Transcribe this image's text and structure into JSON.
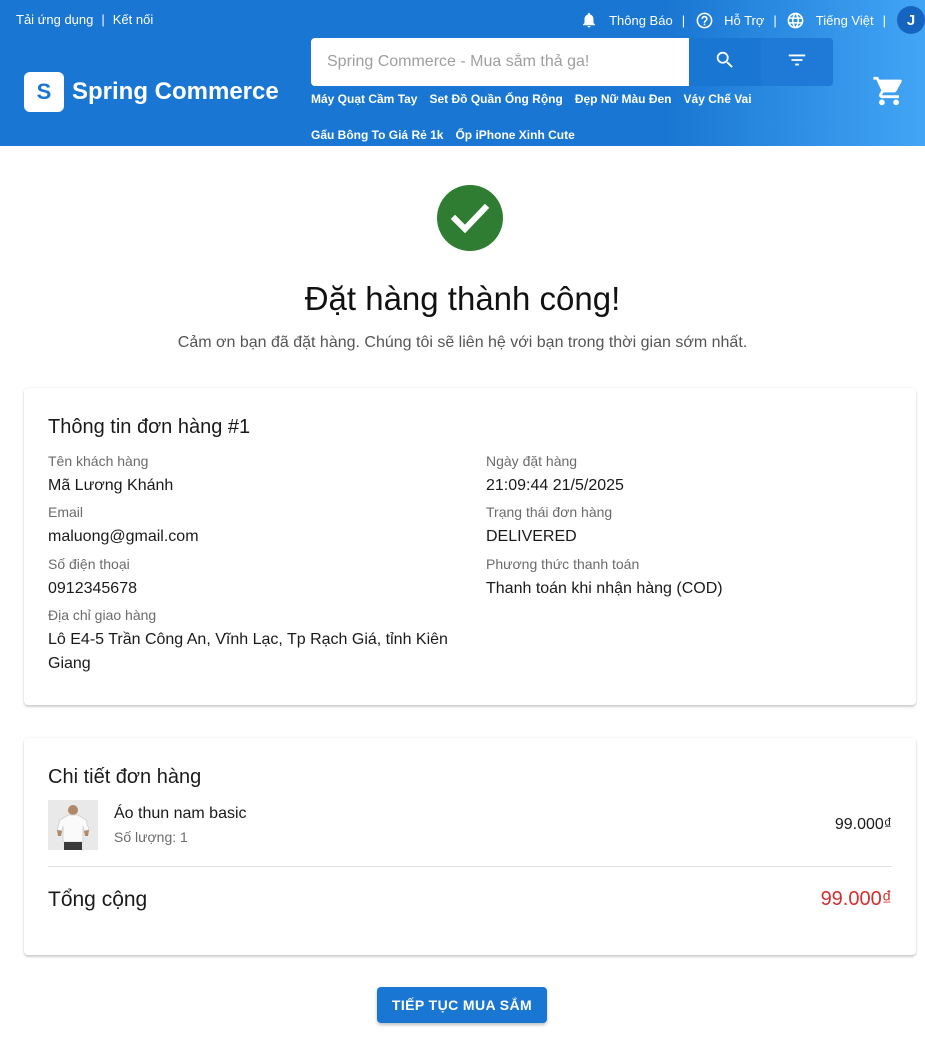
{
  "header": {
    "download_app": "Tải ứng dụng",
    "separator": "|",
    "connect": "Kết nối",
    "notifications": "Thông Báo",
    "support": "Hỗ Trợ",
    "language": "Tiếng Việt",
    "avatar_letter": "J",
    "logo_letter": "S",
    "brand": "Spring Commerce",
    "search_placeholder": "Spring Commerce - Mua sắm thả ga!",
    "tags": [
      "Máy Quạt Cầm Tay",
      "Set Đồ Quần Ống Rộng",
      "Đẹp Nữ Màu Đen",
      "Váy Chế Vai",
      "Gấu Bông To Giá Rẻ 1k",
      "Ốp iPhone Xinh Cute"
    ],
    "icons": [
      "bell-icon",
      "help-circle-icon",
      "globe-icon",
      "search-icon",
      "filter-icon",
      "cart-icon"
    ]
  },
  "success": {
    "icon": "check-circle-icon",
    "title": "Đặt hàng thành công!",
    "message": "Cảm ơn bạn đã đặt hàng. Chúng tôi sẽ liên hệ với bạn trong thời gian sớm nhất."
  },
  "order_info": {
    "title": "Thông tin đơn hàng #1",
    "customer_name_label": "Tên khách hàng",
    "customer_name": "Mã Lương Khánh",
    "email_label": "Email",
    "email": "maluong@gmail.com",
    "phone_label": "Số điện thoại",
    "phone": "0912345678",
    "address_label": "Địa chỉ giao hàng",
    "address": "Lô E4-5 Trần Công An, Vĩnh Lạc, Tp Rạch Giá, tỉnh Kiên Giang",
    "order_date_label": "Ngày đặt hàng",
    "order_date": "21:09:44 21/5/2025",
    "status_label": "Trạng thái đơn hàng",
    "status": "DELIVERED",
    "payment_label": "Phương thức thanh toán",
    "payment": "Thanh toán khi nhận hàng (COD)"
  },
  "order_details": {
    "title": "Chi tiết đơn hàng",
    "items": [
      {
        "name": "Áo thun nam basic",
        "quantity_text": "Số lượng: 1",
        "price": "99.000₫"
      }
    ],
    "total_label": "Tổng cộng",
    "total": "99.000₫"
  },
  "actions": {
    "continue_label": "TIẾP TỤC MUA SẮM"
  },
  "colors": {
    "primary": "#1976d2",
    "success": "#2e7d32",
    "total": "#d32f2f"
  }
}
